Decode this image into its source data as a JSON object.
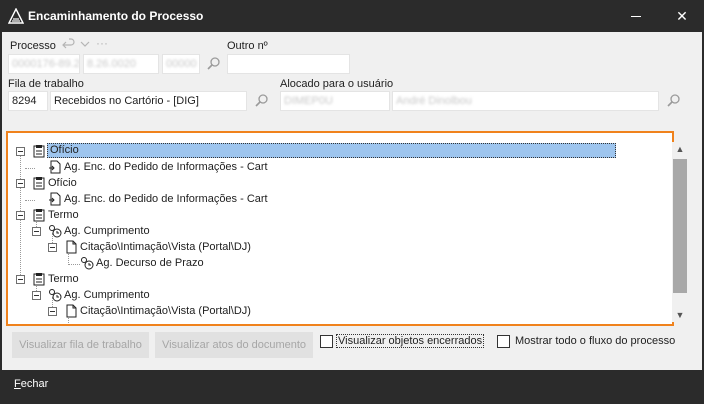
{
  "window": {
    "title": "Encaminhamento do Processo",
    "close_glyph": "✕"
  },
  "processo": {
    "label": "Processo",
    "history_icons": [
      "undo-icon",
      "chevron-down-icon",
      "more-icon"
    ],
    "field1": "0000176-89.2018",
    "field2": "8.26.0020",
    "field3": "00000"
  },
  "outro": {
    "label": "Outro nº",
    "value": ""
  },
  "fila": {
    "label": "Fila de trabalho",
    "code": "8294",
    "name": "Recebidos no Cartório - [DIG]"
  },
  "alocado": {
    "label": "Alocado para o usuário",
    "code": "DIMEP0U",
    "name": "André Dinolbou"
  },
  "tree": [
    {
      "text": "Ofício",
      "icon": "document-clipboard-icon",
      "selected": true
    },
    {
      "text": "Ag. Enc. do Pedido de Informações - Cart",
      "icon": "forward-doc-icon"
    },
    {
      "text": "Ofício",
      "icon": "document-clipboard-icon"
    },
    {
      "text": "Ag. Enc. do Pedido de Informações - Cart",
      "icon": "forward-doc-icon"
    },
    {
      "text": "Termo",
      "icon": "document-clipboard-icon"
    },
    {
      "text": "Ag. Cumprimento",
      "icon": "process-clock-icon"
    },
    {
      "text": "Citação\\Intimação\\Vista (Portal\\DJ)",
      "icon": "page-icon"
    },
    {
      "text": "Ag. Decurso de Prazo",
      "icon": "process-clock-icon"
    },
    {
      "text": "Termo",
      "icon": "document-clipboard-icon"
    },
    {
      "text": "Ag. Cumprimento",
      "icon": "process-clock-icon"
    },
    {
      "text": "Citação\\Intimação\\Vista (Portal\\DJ)",
      "icon": "page-icon"
    }
  ],
  "buttons": {
    "visualizar_fila": "Visualizar fila de trabalho",
    "visualizar_atos": "Visualizar atos do documento"
  },
  "checkboxes": {
    "encerrados": {
      "label": "Visualizar objetos encerrados",
      "checked": false
    },
    "fluxo": {
      "label": "Mostrar todo o fluxo do processo",
      "checked": false
    }
  },
  "footer": {
    "fechar_first": "F",
    "fechar_rest": "echar"
  },
  "colors": {
    "accent_border": "#f0821c",
    "selection": "#9ec5ee",
    "titlebar": "#2b2b2b"
  }
}
